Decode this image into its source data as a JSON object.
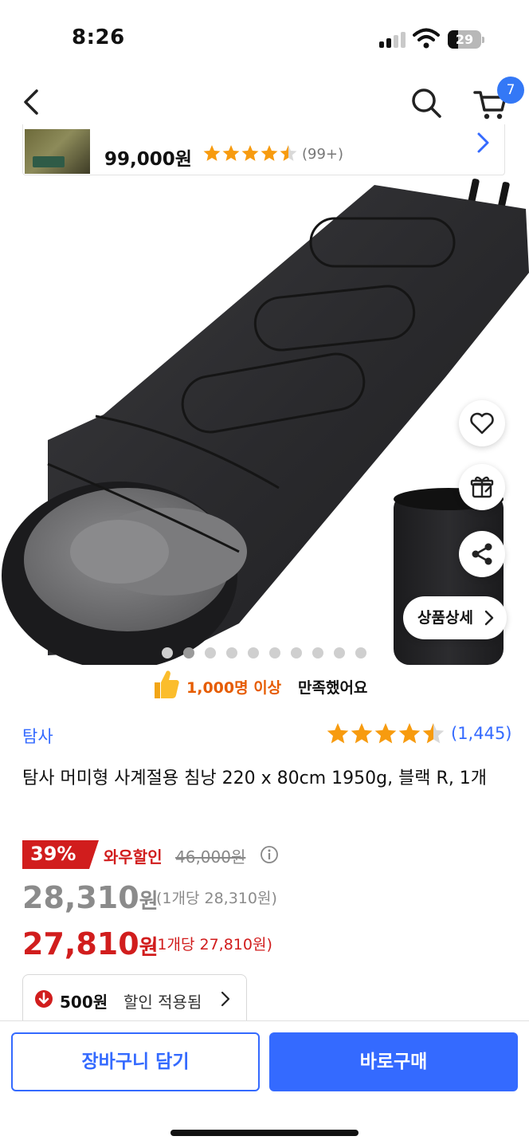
{
  "status_bar": {
    "time": "8:26",
    "battery": "29"
  },
  "nav": {
    "cart_count": "7",
    "icons": [
      "back-arrow-icon",
      "search-icon",
      "cart-icon"
    ]
  },
  "recommendation": {
    "price": "99,000원",
    "rating": 4.5,
    "review_count": "(99+)"
  },
  "hero": {
    "detail_button": "상품상세",
    "image_count": 10,
    "active_image": 1,
    "float_icons": [
      "heart-icon",
      "gift-icon",
      "share-icon"
    ]
  },
  "satisfaction": {
    "highlight": "1,000명 이상",
    "text": "만족했어요"
  },
  "product": {
    "brand": "탐사",
    "rating": 4.5,
    "review_count": "(1,445)",
    "title": "탐사 머미형 사계절용 침낭 220 x 80cm 1950g, 블랙 R, 1개"
  },
  "pricing": {
    "discount_percent": "39%",
    "discount_label": "와우할인",
    "original_price": "46,000원",
    "price_value": "28,310",
    "price_unit": "원",
    "price_per_unit": "(1개당 28,310원)",
    "wow_price_value": "27,810",
    "wow_price_unit": "원",
    "wow_per_unit": "(1개당 27,810원)",
    "accent_red": "#d11d1d",
    "accent_blue": "#346aff"
  },
  "coupon": {
    "amount": "500원",
    "text": "할인 적용됨"
  },
  "actions": {
    "add_to_cart": "장바구니 담기",
    "buy_now": "바로구매"
  }
}
